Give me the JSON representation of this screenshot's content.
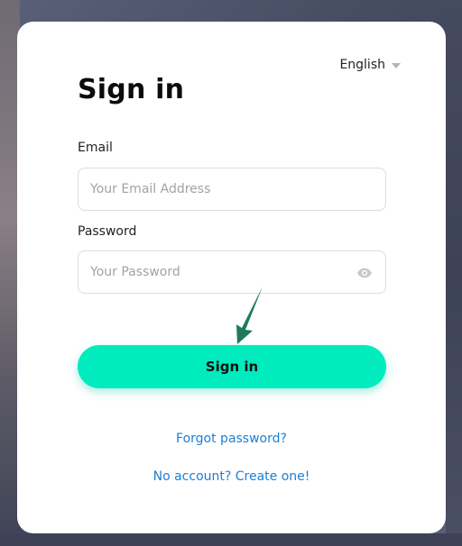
{
  "language": {
    "selected": "English"
  },
  "title": "Sign in",
  "email": {
    "label": "Email",
    "placeholder": "Your Email Address",
    "value": ""
  },
  "password": {
    "label": "Password",
    "placeholder": "Your Password",
    "value": "",
    "toggle_icon": "eye-icon"
  },
  "sign_in_button": "Sign in",
  "links": {
    "forgot": "Forgot password?",
    "create": "No account? Create one!"
  },
  "colors": {
    "accent": "#00ecbf",
    "link": "#1a7fd6",
    "annotation_arrow": "#1f7a5c"
  }
}
